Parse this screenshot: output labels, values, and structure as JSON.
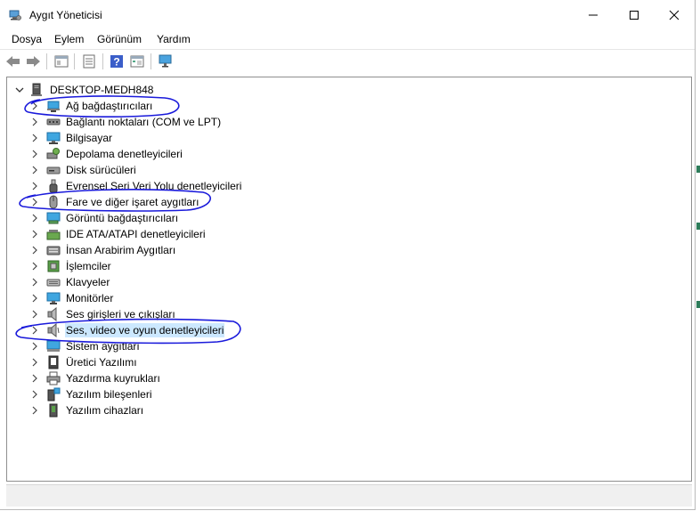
{
  "window": {
    "title": "Aygıt Yöneticisi"
  },
  "menu": {
    "items": [
      "Dosya",
      "Eylem",
      "Görünüm",
      "Yardım"
    ]
  },
  "toolbar": {
    "icons": [
      "back-arrow-icon",
      "forward-arrow-icon",
      "show-hide-tree-icon",
      "properties-icon",
      "help-icon",
      "view-icon",
      "scan-monitor-icon"
    ]
  },
  "tree": {
    "root": "DESKTOP-MEDH848",
    "categories": [
      {
        "label": "Ağ bağdaştırıcıları",
        "icon": "network-adapter-icon"
      },
      {
        "label": "Bağlantı noktaları (COM ve LPT)",
        "icon": "port-icon"
      },
      {
        "label": "Bilgisayar",
        "icon": "computer-icon"
      },
      {
        "label": "Depolama denetleyicileri",
        "icon": "storage-controller-icon"
      },
      {
        "label": "Disk sürücüleri",
        "icon": "disk-drive-icon"
      },
      {
        "label": "Evrensel Seri Veri Yolu denetleyicileri",
        "icon": "usb-icon"
      },
      {
        "label": "Fare ve diğer işaret aygıtları",
        "icon": "mouse-icon"
      },
      {
        "label": "Görüntü bağdaştırıcıları",
        "icon": "display-adapter-icon"
      },
      {
        "label": "IDE ATA/ATAPI denetleyicileri",
        "icon": "ide-controller-icon"
      },
      {
        "label": "İnsan Arabirim Aygıtları",
        "icon": "hid-icon"
      },
      {
        "label": "İşlemciler",
        "icon": "processor-icon"
      },
      {
        "label": "Klavyeler",
        "icon": "keyboard-icon"
      },
      {
        "label": "Monitörler",
        "icon": "monitor-icon"
      },
      {
        "label": "Ses girişleri ve çıkışları",
        "icon": "speaker-icon"
      },
      {
        "label": "Ses, video ve oyun denetleyicileri",
        "icon": "sound-video-icon",
        "selected": true
      },
      {
        "label": "Sistem aygıtları",
        "icon": "system-device-icon"
      },
      {
        "label": "Üretici Yazılımı",
        "icon": "firmware-icon"
      },
      {
        "label": "Yazdırma kuyrukları",
        "icon": "printer-icon"
      },
      {
        "label": "Yazılım bileşenleri",
        "icon": "software-component-icon"
      },
      {
        "label": "Yazılım cihazları",
        "icon": "software-device-icon"
      }
    ]
  },
  "colors": {
    "selection": "#cce8ff",
    "annotation": "#1a1adb"
  }
}
